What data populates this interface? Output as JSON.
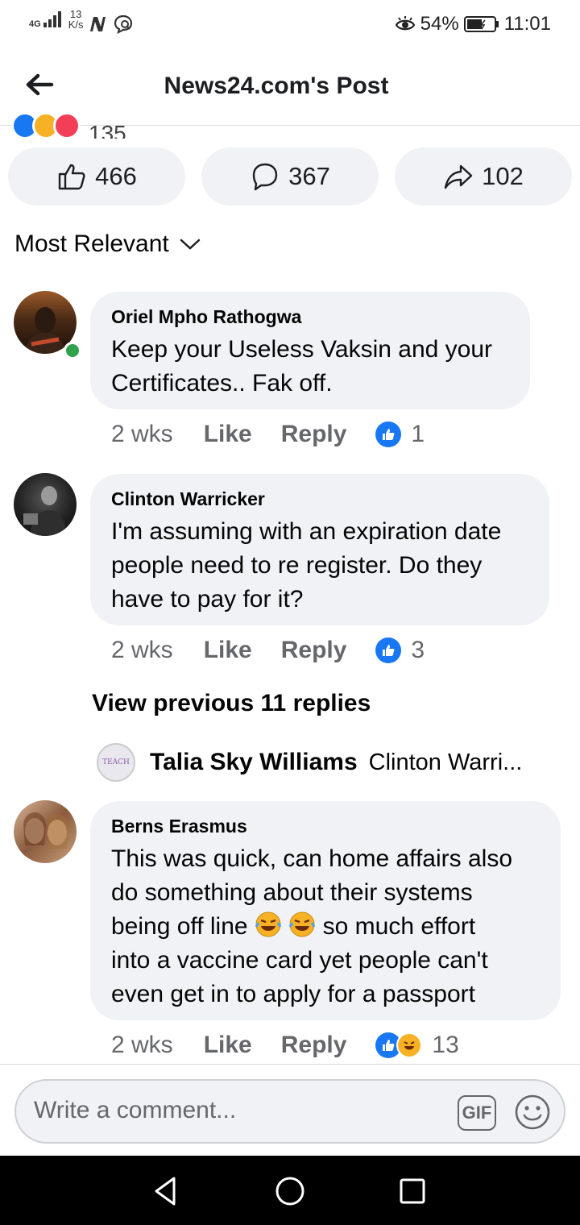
{
  "status_bar": {
    "network": "4G",
    "speed_value": "13",
    "speed_unit": "K/s",
    "battery": "54%",
    "time": "11:01"
  },
  "header": {
    "title": "News24.com's Post"
  },
  "post_stats": {
    "reactions_partial": "135",
    "likes": "466",
    "comments": "367",
    "shares": "102"
  },
  "sort": {
    "label": "Most Relevant"
  },
  "comments": [
    {
      "author": "Oriel Mpho Rathogwa",
      "text_lines": [
        "Keep your Useless Vaksin and your",
        "Certificates.. Fak off."
      ],
      "time": "2 wks",
      "like_label": "Like",
      "reply_label": "Reply",
      "reaction_count": "1"
    },
    {
      "author": "Clinton Warricker",
      "text_lines": [
        "I'm assuming with an expiration date",
        "people need to re register. Do they",
        "have to pay for it?"
      ],
      "time": "2 wks",
      "like_label": "Like",
      "reply_label": "Reply",
      "reaction_count": "3",
      "view_previous": "View previous 11 replies",
      "last_reply": {
        "author": "Talia Sky Williams",
        "preview": "Clinton Warri...",
        "avatar_text": "TEACH"
      }
    },
    {
      "author": "Berns Erasmus",
      "text_lines": [
        "This was quick, can home affairs also",
        "do something about their systems",
        "being off line",
        "so much effort",
        "into a vaccine card yet people can't",
        "even get in to apply for a passport"
      ],
      "time": "2 wks",
      "like_label": "Like",
      "reply_label": "Reply",
      "reaction_count": "13"
    }
  ],
  "composer": {
    "placeholder": "Write a comment...",
    "gif_label": "GIF"
  },
  "colors": {
    "facebook_blue": "#1877f2",
    "bubble_bg": "#f0f2f5",
    "secondary_text": "#65676b",
    "online_green": "#31a24c"
  }
}
